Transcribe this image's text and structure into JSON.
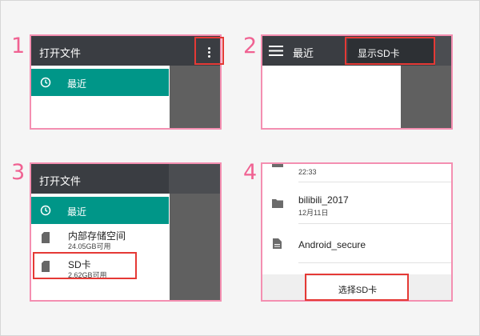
{
  "steps": [
    "1",
    "2",
    "3",
    "4"
  ],
  "panel1": {
    "title": "打开文件",
    "recent_label": "最近"
  },
  "panel2": {
    "recent_label": "最近",
    "menu_item": "显示SD卡"
  },
  "panel3": {
    "title": "打开文件",
    "recent_label": "最近",
    "internal_label": "内部存储空间",
    "internal_sub": "24.05GB可用",
    "sd_label": "SD卡",
    "sd_sub": "2.62GB可用"
  },
  "panel4": {
    "top_time": "22:33",
    "folder_name": "bilibili_2017",
    "folder_date": "12月11日",
    "file_name": "Android_secure",
    "select_button": "选择SD卡"
  },
  "colors": {
    "accent_pink": "#f06292",
    "teal": "#009688",
    "highlight_red": "#e53935",
    "appbar": "#3a3d42"
  }
}
